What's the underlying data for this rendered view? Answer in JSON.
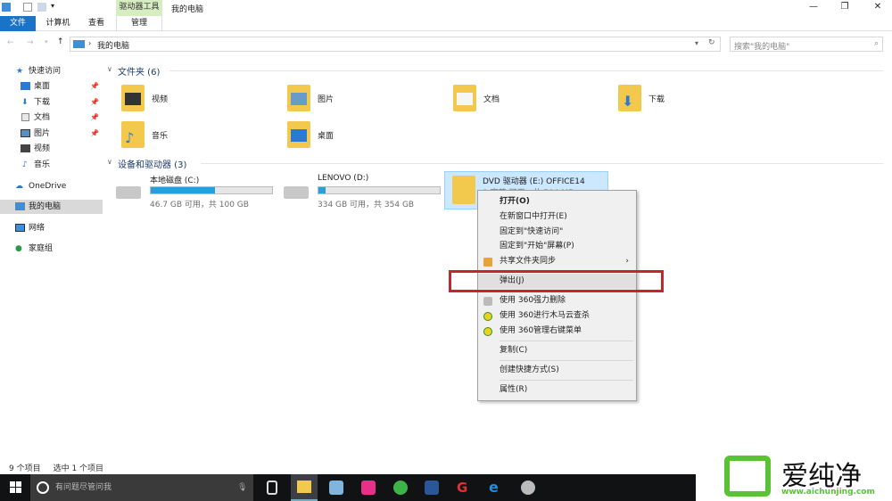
{
  "window": {
    "title": "我的电脑",
    "tool_tab": "驱动器工具",
    "controls": [
      "—",
      "❐",
      "✕"
    ]
  },
  "ribbon": {
    "tabs": [
      "文件",
      "计算机",
      "查看",
      "管理"
    ]
  },
  "address": {
    "path": "我的电脑",
    "search_placeholder": "搜索\"我的电脑\""
  },
  "sidebar": {
    "items": [
      {
        "label": "快速访问",
        "pinned": false
      },
      {
        "label": "桌面",
        "pinned": true
      },
      {
        "label": "下载",
        "pinned": true
      },
      {
        "label": "文档",
        "pinned": true
      },
      {
        "label": "图片",
        "pinned": true
      },
      {
        "label": "视频",
        "pinned": false
      },
      {
        "label": "音乐",
        "pinned": false
      },
      {
        "label": "OneDrive",
        "pinned": false
      },
      {
        "label": "我的电脑",
        "pinned": false
      },
      {
        "label": "网络",
        "pinned": false
      },
      {
        "label": "家庭组",
        "pinned": false
      }
    ]
  },
  "folders": {
    "header": "文件夹 (6)",
    "items": [
      "视频",
      "图片",
      "文档",
      "下载",
      "音乐",
      "桌面"
    ]
  },
  "drives": {
    "header": "设备和驱动器 (3)",
    "items": [
      {
        "name": "本地磁盘 (C:)",
        "free": "46.7 GB 可用，共 100 GB",
        "used_pct": 53
      },
      {
        "name": "LENOVO (D:)",
        "free": "334 GB 可用，共 354 GB",
        "used_pct": 6
      },
      {
        "name": "DVD 驱动器 (E:) OFFICE14",
        "free": "0 字节 可用，共 504 MB",
        "used_pct": 100
      }
    ]
  },
  "context_menu": {
    "items": [
      "打开(O)",
      "在新窗口中打开(E)",
      "固定到\"快速访问\"",
      "固定到\"开始\"屏幕(P)",
      "共享文件夹同步",
      "弹出(J)",
      "使用 360强力删除",
      "使用 360进行木马云查杀",
      "使用 360管理右键菜单",
      "复制(C)",
      "创建快捷方式(S)",
      "属性(R)"
    ],
    "submenu_arrow": "›"
  },
  "status": {
    "count": "9 个项目",
    "selected": "选中 1 个项目"
  },
  "taskbar": {
    "search_placeholder": "有问题尽管问我"
  },
  "watermark": {
    "brand": "爱纯净",
    "url": "www.aichunjing.com"
  },
  "colors": {
    "accent": "#1a73c6",
    "highlight": "#cce8ff",
    "red_box": "#c0282d"
  }
}
